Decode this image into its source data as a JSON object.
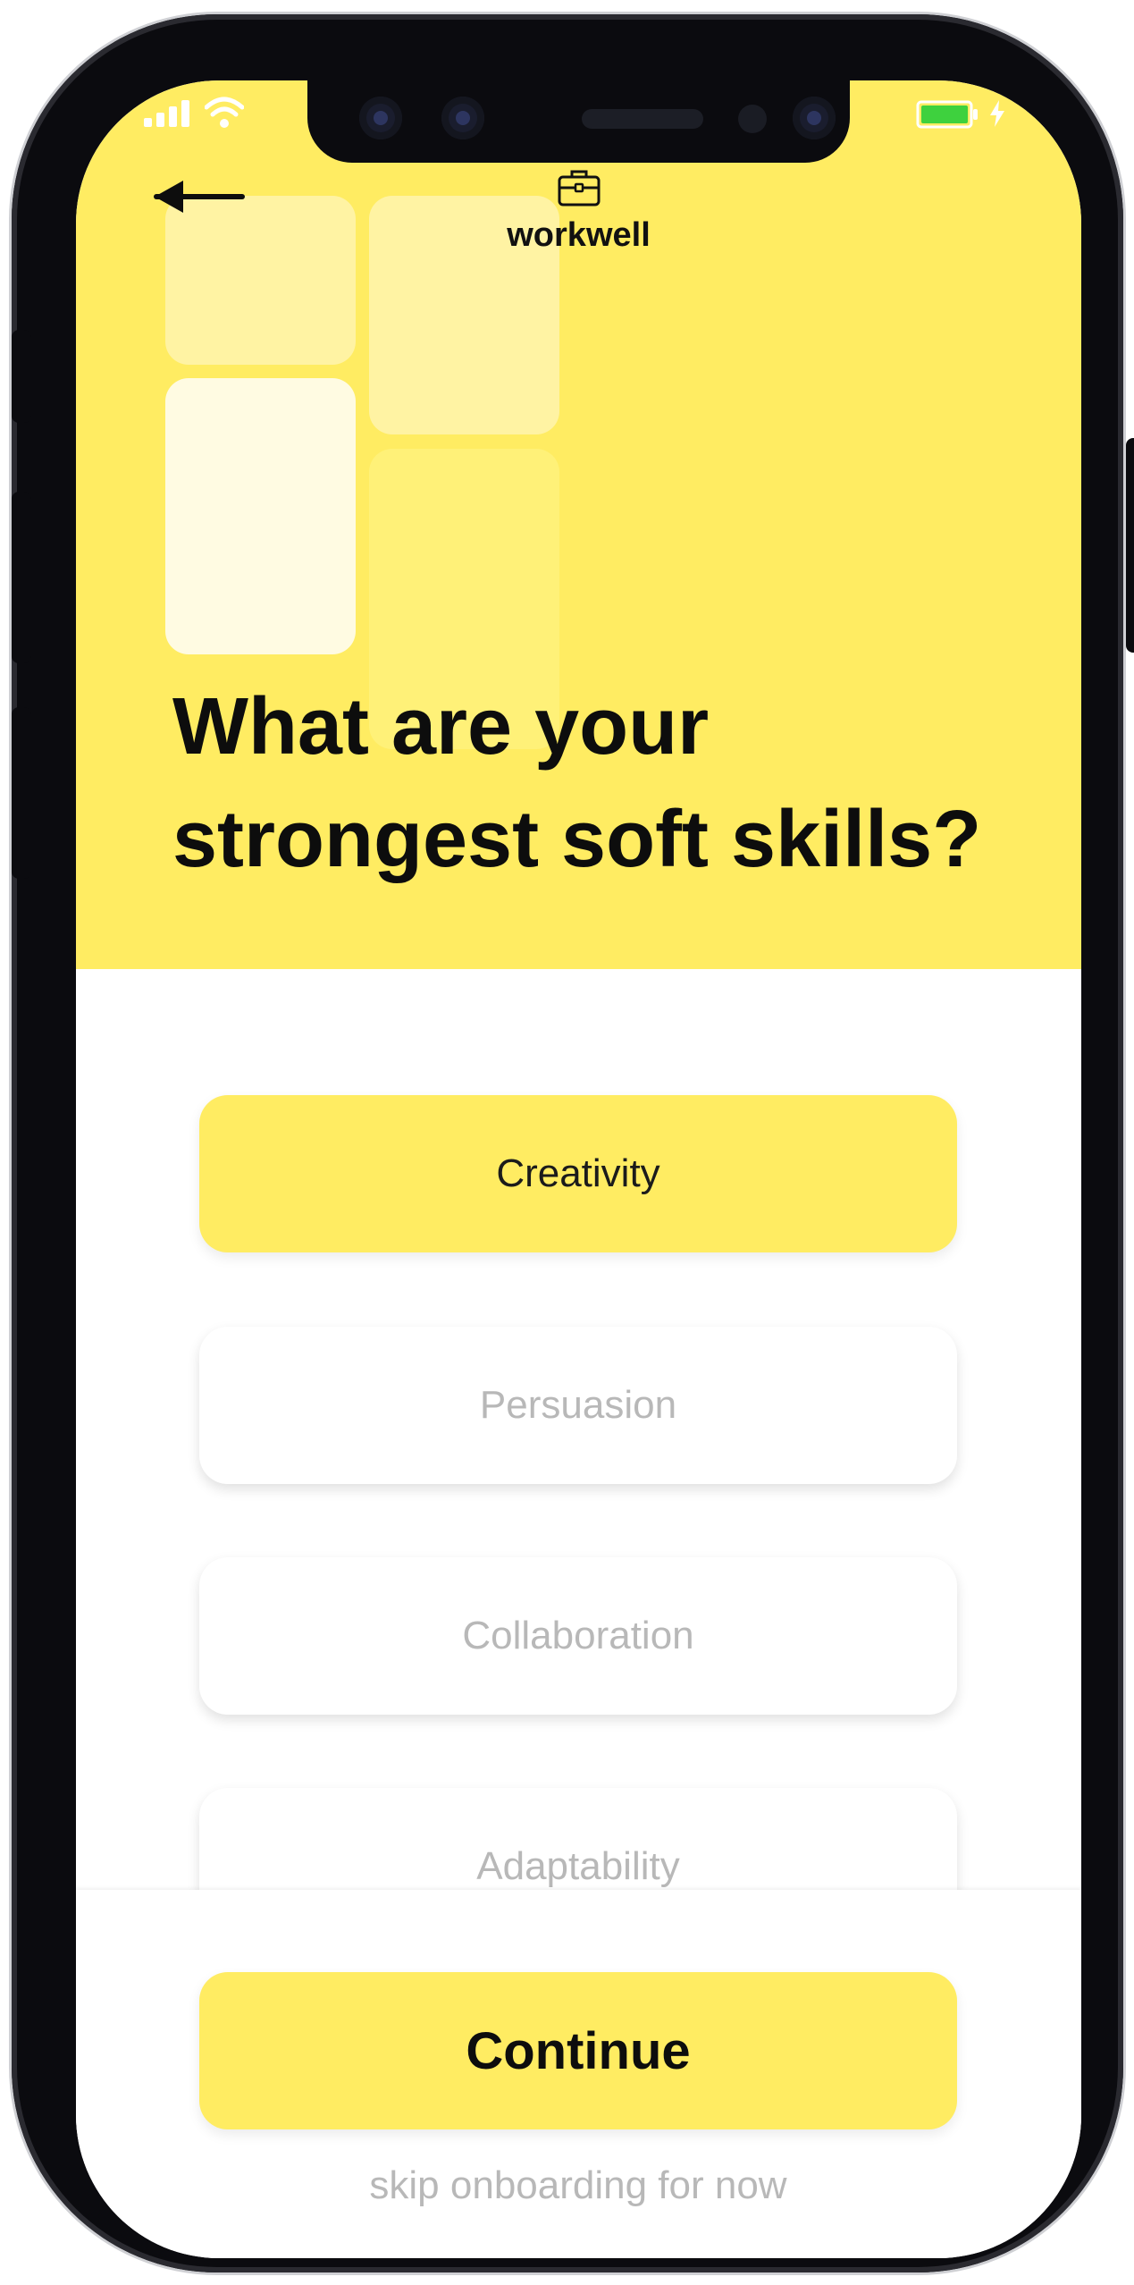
{
  "app": {
    "brand_name": "workwell",
    "brand_icon": "briefcase-icon"
  },
  "status_bar": {
    "battery_icon": "battery-icon",
    "signal_icon": "signal-icon",
    "wifi_icon": "wifi-icon",
    "charging_icon": "bolt-icon"
  },
  "header": {
    "back_icon": "back-arrow-icon"
  },
  "question": {
    "line1": "What are your",
    "line2": "strongest soft skills?"
  },
  "options": [
    {
      "label": "Creativity",
      "selected": true
    },
    {
      "label": "Persuasion",
      "selected": false
    },
    {
      "label": "Collaboration",
      "selected": false
    },
    {
      "label": "Adaptability",
      "selected": false
    }
  ],
  "footer": {
    "continue_label": "Continue",
    "skip_label": "skip onboarding for now"
  },
  "colors": {
    "accent": "#ffec62",
    "text": "#0d0d0d",
    "muted": "#b8b8b8"
  }
}
